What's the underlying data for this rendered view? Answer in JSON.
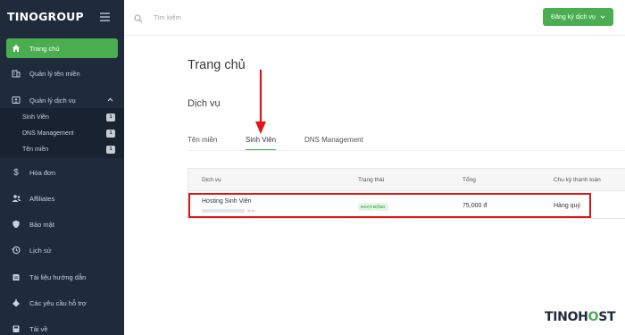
{
  "brand": "TINOGROUP",
  "sidebar": {
    "items": [
      {
        "label": "Trang chủ",
        "icon": "home-icon"
      },
      {
        "label": "Quản lý tên miền",
        "icon": "building-icon"
      },
      {
        "label": "Quản lý dịch vụ",
        "icon": "id-card-icon"
      },
      {
        "label": "Hóa đơn",
        "icon": "dollar-icon"
      },
      {
        "label": "Affiliates",
        "icon": "users-icon"
      },
      {
        "label": "Bảo mật",
        "icon": "shield-icon"
      },
      {
        "label": "Lịch sử",
        "icon": "history-icon"
      },
      {
        "label": "Tài liệu hướng dẫn",
        "icon": "document-icon"
      },
      {
        "label": "Các yêu cầu hỗ trợ",
        "icon": "ticket-icon"
      },
      {
        "label": "Tải về",
        "icon": "download-icon"
      }
    ],
    "sub_items": [
      {
        "label": "Sinh Viên",
        "count": "1"
      },
      {
        "label": "DNS Management",
        "count": "1"
      },
      {
        "label": "Tên miền",
        "count": "1"
      }
    ]
  },
  "topbar": {
    "search_placeholder": "Tìm kiếm",
    "register_label": "Đăng ký dịch vụ"
  },
  "main": {
    "page_title": "Trang chủ",
    "section_title": "Dịch vụ",
    "tabs": [
      {
        "label": "Tên miền",
        "active": false
      },
      {
        "label": "Sinh Viên",
        "active": true
      },
      {
        "label": "DNS Management",
        "active": false
      }
    ],
    "table": {
      "headers": [
        "Dịch vụ",
        "Trạng thái",
        "Tổng",
        "Chu kỳ thanh toán"
      ],
      "row": {
        "service": "Hosting Sinh Viên",
        "domain_suffix": ".id.vn",
        "status": "HOẠT ĐỘNG",
        "total": "75,000 đ",
        "cycle": "Hàng quý"
      }
    }
  },
  "watermark": {
    "part1": "TINOH",
    "part2": "O",
    "part3": "ST"
  },
  "colors": {
    "accent": "#4aae50",
    "sidebar": "#1f2b3a",
    "highlight": "#e21515"
  }
}
